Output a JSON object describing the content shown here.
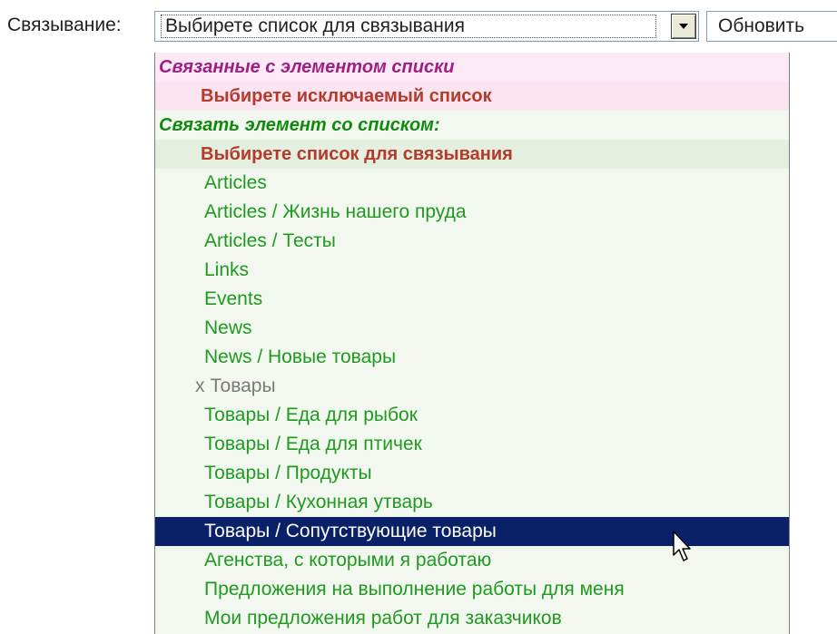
{
  "toolbar": {
    "link_label": "Связывание:",
    "select_value": "Выбирете список для связывания",
    "refresh_label": "Обновить"
  },
  "dropdown": {
    "linked_group": {
      "header": "Связанные с элементом списки",
      "placeholder": "Выбирете исключаемый список"
    },
    "link_group": {
      "header": "Связать элемент со списком:",
      "placeholder": "Выбирете список для связывания"
    },
    "options": [
      "Articles",
      "Articles / Жизнь нашего пруда",
      "Articles / Тесты",
      "Links",
      "Events",
      "News",
      "News / Новые товары",
      "x Товары",
      "Товары / Еда для рыбок",
      "Товары / Еда для птичек",
      "Товары / Продукты",
      "Товары / Кухонная утварь",
      "Товары / Сопутствующие товары",
      "Агенства, с которыми я работаю",
      "Предложения на выполнение работы для меня",
      "Мои предложения работ для заказчиков"
    ],
    "selected_option": "Товары / Сопутствующие товары",
    "disabled_option": "x Товары"
  },
  "colors": {
    "selected_bg": "#0a2068",
    "option_text": "#1f9a1f",
    "placeholder_text": "#b23b2c",
    "linked_header_text": "#9e1f83",
    "link_header_text": "#0e8a0e"
  },
  "icons": {
    "dropdown_arrow": "chevron-down-icon",
    "cursor": "mouse-pointer-icon"
  }
}
